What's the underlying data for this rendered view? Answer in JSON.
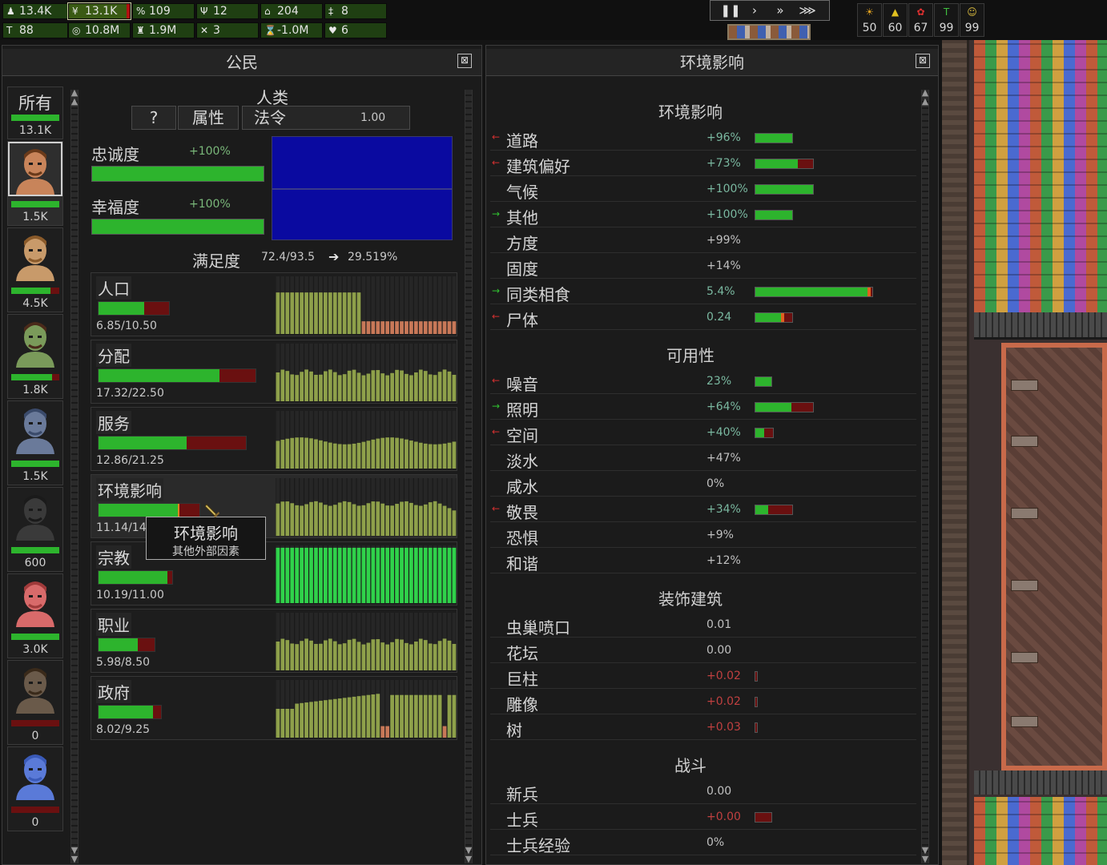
{
  "topbar": {
    "row1": [
      {
        "icon": "♟",
        "icon_name": "population-icon",
        "value": "13.4K"
      },
      {
        "icon": "¥",
        "icon_name": "citizens-icon",
        "value": "13.1K",
        "selected": true
      },
      {
        "icon": "%",
        "icon_name": "chain-icon",
        "value": "109"
      },
      {
        "icon": "Ψ",
        "icon_name": "wheat-icon",
        "value": "12"
      },
      {
        "icon": "⌂",
        "icon_name": "house-icon",
        "value": "204"
      },
      {
        "icon": "‡",
        "icon_name": "shrine-icon",
        "value": "8"
      }
    ],
    "row2": [
      {
        "icon": "T",
        "icon_name": "worker-icon",
        "value": "88"
      },
      {
        "icon": "◎",
        "icon_name": "coins-icon",
        "value": "10.8M"
      },
      {
        "icon": "♜",
        "icon_name": "tower-icon",
        "value": "1.9M"
      },
      {
        "icon": "✕",
        "icon_name": "swords-icon",
        "value": "3"
      },
      {
        "icon": "⌛",
        "icon_name": "hourglass-icon",
        "value": "-1.0M"
      },
      {
        "icon": "♥",
        "icon_name": "heart-icon",
        "value": "6"
      }
    ]
  },
  "speed": {
    "pause": "❚❚",
    "play": "›",
    "fast": "»",
    "fastest": "⋙"
  },
  "counters": [
    {
      "icon": "☀",
      "icon_name": "sun-icon",
      "color": "#e0a020",
      "value": "50"
    },
    {
      "icon": "▲",
      "icon_name": "warning-icon",
      "color": "#e0c020",
      "value": "60"
    },
    {
      "icon": "✿",
      "icon_name": "flower-icon",
      "color": "#e03030",
      "value": "67"
    },
    {
      "icon": "T",
      "icon_name": "trident-icon",
      "color": "#40c040",
      "value": "99"
    },
    {
      "icon": "☺",
      "icon_name": "face-icon",
      "color": "#e0c040",
      "value": "99"
    }
  ],
  "citizens": {
    "title": "公民",
    "close": "⊠",
    "all": {
      "label": "所有",
      "value": "13.1K",
      "fill": 1.0
    },
    "species": [
      {
        "value": "1.5K",
        "fill": 1.0,
        "skin": "#c8845a",
        "hair": "#6a3a1a",
        "selected": true
      },
      {
        "value": "4.5K",
        "fill": 0.82,
        "skin": "#c89a6a",
        "hair": "#8a5a2a"
      },
      {
        "value": "1.8K",
        "fill": 0.85,
        "skin": "#7a9a5a",
        "hair": "#4a2a1a"
      },
      {
        "value": "1.5K",
        "fill": 1.0,
        "skin": "#6a7a9a",
        "hair": "#3a4a6a"
      },
      {
        "value": "600",
        "fill": 1.0,
        "skin": "#3a3a3a",
        "hair": "#1a1a1a"
      },
      {
        "value": "3.0K",
        "fill": 1.0,
        "skin": "#d86a6a",
        "hair": "#a03a3a"
      },
      {
        "value": "0",
        "fill": 0.0,
        "skin": "#6a5a4a",
        "hair": "#3a2a1a"
      },
      {
        "value": "0",
        "fill": 0.0,
        "skin": "#5a7ad8",
        "hair": "#3a5ab8"
      }
    ],
    "race_name": "人类",
    "tabs": {
      "help": "?",
      "attributes": "属性",
      "decree": "法令",
      "decree_value": "1.00"
    },
    "loyalty": {
      "label": "忠诚度",
      "pct": "+100%",
      "fill": 1.0
    },
    "happiness": {
      "label": "幸福度",
      "pct": "+100%",
      "fill": 1.0
    },
    "satisfaction": {
      "label": "满足度",
      "value": "72.4/93.5",
      "arrow": "➔",
      "rate": "29.519%"
    },
    "needs": [
      {
        "label": "人口",
        "value": "6.85/10.50",
        "fill": 0.65,
        "width": 90,
        "hist": "population"
      },
      {
        "label": "分配",
        "value": "17.32/22.50",
        "fill": 0.77,
        "width": 198,
        "hist": "flat"
      },
      {
        "label": "服务",
        "value": "12.86/21.25",
        "fill": 0.6,
        "width": 186,
        "hist": "wave"
      },
      {
        "label": "环境影响",
        "value": "11.14/14.0",
        "fill": 0.79,
        "width": 128,
        "hist": "decline",
        "highlight": true
      },
      {
        "label": "宗教",
        "value": "10.19/11.00",
        "fill": 0.93,
        "width": 94,
        "hist": "full"
      },
      {
        "label": "职业",
        "value": "5.98/8.50",
        "fill": 0.7,
        "width": 72,
        "hist": "flat"
      },
      {
        "label": "政府",
        "value": "8.02/9.25",
        "fill": 0.87,
        "width": 80,
        "hist": "gov"
      }
    ],
    "tooltip": {
      "title": "环境影响",
      "subtitle": "其他外部因素"
    }
  },
  "env": {
    "title": "环境影响",
    "close": "⊠",
    "sections": [
      {
        "title": "环境影响",
        "rows": [
          {
            "icon": "←",
            "icon_name": "arrow-left-icon",
            "icolor": "#d03030",
            "label": "道路",
            "value": "+96%",
            "vcolor": "#7ab8a0",
            "bar": {
              "w": 48,
              "fill": 1.0
            }
          },
          {
            "icon": "←",
            "icon_name": "arrow-left-icon",
            "icolor": "#d03030",
            "label": "建筑偏好",
            "value": "+73%",
            "vcolor": "#7ab8a0",
            "bar": {
              "w": 74,
              "fill": 0.73
            }
          },
          {
            "icon": "",
            "icon_name": "",
            "icolor": "",
            "label": "气候",
            "value": "+100%",
            "vcolor": "#7ab8a0",
            "bar": {
              "w": 74,
              "fill": 1.0
            }
          },
          {
            "icon": "→",
            "icon_name": "arrow-right-icon",
            "icolor": "#30c030",
            "label": "其他",
            "value": "+100%",
            "vcolor": "#7ab8a0",
            "bar": {
              "w": 48,
              "fill": 1.0
            }
          },
          {
            "icon": "",
            "icon_name": "",
            "icolor": "",
            "label": "方度",
            "value": "+99%",
            "vcolor": "#c0c0c0"
          },
          {
            "icon": "",
            "icon_name": "",
            "icolor": "",
            "label": "固度",
            "value": "+14%",
            "vcolor": "#c0c0c0"
          },
          {
            "icon": "→",
            "icon_name": "arrow-right-icon",
            "icolor": "#30c030",
            "label": "同类相食",
            "value": "5.4%",
            "vcolor": "#7ab8a0",
            "bar": {
              "w": 148,
              "fill": 0.97,
              "marker": true
            }
          },
          {
            "icon": "←",
            "icon_name": "arrow-left-icon",
            "icolor": "#d03030",
            "label": "尸体",
            "value": "0.24",
            "vcolor": "#7ab8a0",
            "bar": {
              "w": 48,
              "fill": 0.75,
              "marker": true
            }
          }
        ]
      },
      {
        "title": "可用性",
        "rows": [
          {
            "icon": "←",
            "icon_name": "arrow-left-icon",
            "icolor": "#d03030",
            "label": "噪音",
            "value": "23%",
            "vcolor": "#7ab8a0",
            "bar": {
              "w": 22,
              "fill": 1.0
            }
          },
          {
            "icon": "→",
            "icon_name": "arrow-right-icon",
            "icolor": "#30c030",
            "label": "照明",
            "value": "+64%",
            "vcolor": "#7ab8a0",
            "bar": {
              "w": 74,
              "fill": 0.62
            }
          },
          {
            "icon": "←",
            "icon_name": "arrow-left-icon",
            "icolor": "#d03030",
            "label": "空间",
            "value": "+40%",
            "vcolor": "#7ab8a0",
            "bar": {
              "w": 24,
              "fill": 0.5
            }
          },
          {
            "icon": "",
            "icon_name": "",
            "icolor": "",
            "label": "淡水",
            "value": "+47%",
            "vcolor": "#c0c0c0"
          },
          {
            "icon": "",
            "icon_name": "",
            "icolor": "",
            "label": "咸水",
            "value": "0%",
            "vcolor": "#c0c0c0"
          },
          {
            "icon": "←",
            "icon_name": "arrow-left-icon",
            "icolor": "#d03030",
            "label": "敬畏",
            "value": "+34%",
            "vcolor": "#7ab8a0",
            "bar": {
              "w": 48,
              "fill": 0.34
            }
          },
          {
            "icon": "",
            "icon_name": "",
            "icolor": "",
            "label": "恐惧",
            "value": "+9%",
            "vcolor": "#c0c0c0"
          },
          {
            "icon": "",
            "icon_name": "",
            "icolor": "",
            "label": "和谐",
            "value": "+12%",
            "vcolor": "#c0c0c0"
          }
        ]
      },
      {
        "title": "装饰建筑",
        "rows": [
          {
            "icon": "",
            "icon_name": "",
            "icolor": "",
            "label": "虫巢喷口",
            "value": "0.01",
            "vcolor": "#c0c0c0"
          },
          {
            "icon": "",
            "icon_name": "",
            "icolor": "",
            "label": "花坛",
            "value": "0.00",
            "vcolor": "#c0c0c0"
          },
          {
            "icon": "",
            "icon_name": "",
            "icolor": "",
            "label": "巨柱",
            "value": "+0.02",
            "vcolor": "#c04040",
            "bar": {
              "w": 4,
              "fill": 0.0
            }
          },
          {
            "icon": "",
            "icon_name": "",
            "icolor": "",
            "label": "雕像",
            "value": "+0.02",
            "vcolor": "#c04040",
            "bar": {
              "w": 4,
              "fill": 0.0
            }
          },
          {
            "icon": "",
            "icon_name": "",
            "icolor": "",
            "label": "树",
            "value": "+0.03",
            "vcolor": "#c04040",
            "bar": {
              "w": 4,
              "fill": 0.0
            }
          }
        ]
      },
      {
        "title": "战斗",
        "rows": [
          {
            "icon": "",
            "icon_name": "",
            "icolor": "",
            "label": "新兵",
            "value": "0.00",
            "vcolor": "#c0c0c0"
          },
          {
            "icon": "",
            "icon_name": "",
            "icolor": "",
            "label": "士兵",
            "value": "+0.00",
            "vcolor": "#c04040",
            "bar": {
              "w": 22,
              "fill": 0.0
            }
          },
          {
            "icon": "",
            "icon_name": "",
            "icolor": "",
            "label": "士兵经验",
            "value": "0%",
            "vcolor": "#c0c0c0"
          }
        ]
      }
    ]
  }
}
